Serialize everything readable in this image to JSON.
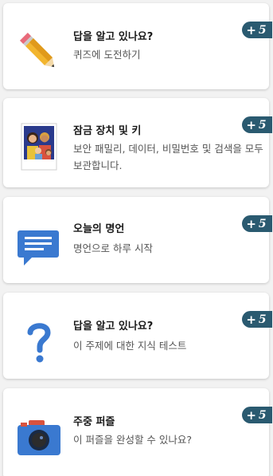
{
  "cards": [
    {
      "title": "답을 알고 있나요?",
      "desc": "퀴즈에 도전하기",
      "badge_plus": "+",
      "badge_num": "5",
      "icon": "pencil-icon"
    },
    {
      "title": "잠금 장치 및 키",
      "desc": "보안 패밀리, 데이터, 비밀번호 및 검색을 모두 보관합니다.",
      "badge_plus": "+",
      "badge_num": "5",
      "icon": "family-photo-icon"
    },
    {
      "title": "오늘의 명언",
      "desc": "명언으로 하루 시작",
      "badge_plus": "+",
      "badge_num": "5",
      "icon": "speech-bubble-icon"
    },
    {
      "title": "답을 알고 있나요?",
      "desc": "이 주제에 대한 지식 테스트",
      "badge_plus": "+",
      "badge_num": "5",
      "icon": "question-mark-icon"
    },
    {
      "title": "주중 퍼즐",
      "desc": "이 퍼즐을 완성할 수 있나요?",
      "badge_plus": "+",
      "badge_num": "5",
      "icon": "camera-icon"
    }
  ],
  "colors": {
    "badge": "#2a5a70",
    "accent_blue": "#3a79d0",
    "pencil_yellow": "#f2b52e"
  }
}
